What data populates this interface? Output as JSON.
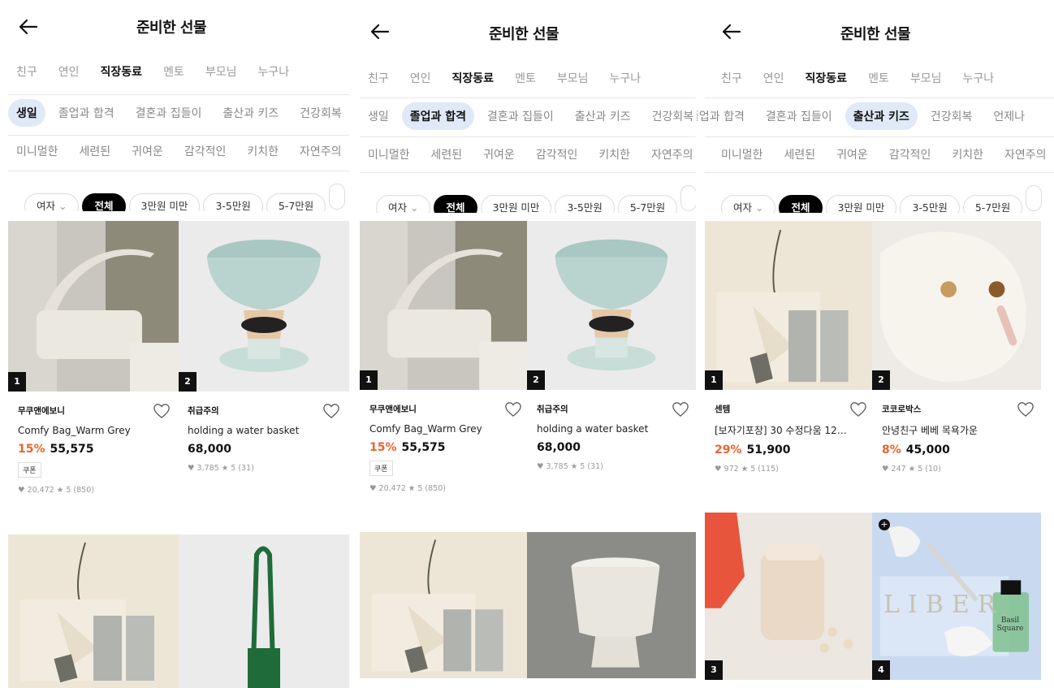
{
  "panels": [
    {
      "title": "준비한 선물",
      "relations": [
        "친구",
        "연인",
        "직장동료",
        "멘토",
        "부모님",
        "누구나"
      ],
      "relation_selected": 2,
      "occasions": [
        "생일",
        "졸업과 합격",
        "결혼과 집들이",
        "출산과 키즈",
        "건강회복"
      ],
      "occasion_selected": 0,
      "styles": [
        "미니멀한",
        "세련된",
        "귀여운",
        "감각적인",
        "키치한",
        "자연주의"
      ],
      "gender": "여자",
      "prices": [
        "전체",
        "3만원 미만",
        "3-5만원",
        "5-7만원"
      ],
      "products": [
        {
          "rank": "1",
          "brand": "무쿠앤에보니",
          "name": "Comfy Bag_Warm Grey",
          "discount": "15%",
          "price": "55,575",
          "coupon": "쿠폰",
          "stats": "♥ 20,472  ★ 5 (850)"
        },
        {
          "rank": "2",
          "brand": "취급주의",
          "name": "holding a water basket",
          "discount": "",
          "price": "68,000",
          "coupon": "",
          "stats": "♥ 3,785  ★ 5 (31)"
        }
      ]
    },
    {
      "title": "준비한 선물",
      "relations": [
        "친구",
        "연인",
        "직장동료",
        "멘토",
        "부모님",
        "누구나"
      ],
      "relation_selected": 2,
      "occasions": [
        "생일",
        "졸업과 합격",
        "결혼과 집들이",
        "출산과 키즈",
        "건강회복"
      ],
      "occasion_selected": 1,
      "styles": [
        "미니멀한",
        "세련된",
        "귀여운",
        "감각적인",
        "키치한",
        "자연주의"
      ],
      "gender": "여자",
      "prices": [
        "전체",
        "3만원 미만",
        "3-5만원",
        "5-7만원"
      ],
      "products": [
        {
          "rank": "1",
          "brand": "무쿠앤에보니",
          "name": "Comfy Bag_Warm Grey",
          "discount": "15%",
          "price": "55,575",
          "coupon": "쿠폰",
          "stats": "♥ 20,472  ★ 5 (850)"
        },
        {
          "rank": "2",
          "brand": "취급주의",
          "name": "holding a water basket",
          "discount": "",
          "price": "68,000",
          "coupon": "",
          "stats": "♥ 3,785  ★ 5 (31)"
        }
      ]
    },
    {
      "title": "준비한 선물",
      "relations": [
        "친구",
        "연인",
        "직장동료",
        "멘토",
        "부모님",
        "누구나"
      ],
      "relation_selected": 2,
      "occasions": [
        "졸업과 합격",
        "결혼과 집들이",
        "출산과 키즈",
        "건강회복",
        "언제나"
      ],
      "occasion_selected": 2,
      "styles": [
        "미니멀한",
        "세련된",
        "귀여운",
        "감각적인",
        "키치한",
        "자연주의"
      ],
      "gender": "여자",
      "prices": [
        "전체",
        "3만원 미만",
        "3-5만원",
        "5-7만원"
      ],
      "products": [
        {
          "rank": "1",
          "brand": "센템",
          "name": "[보자기포장] 30 수정다움 12g...",
          "discount": "29%",
          "price": "51,900",
          "coupon": "",
          "stats": "♥ 972  ★ 5 (115)"
        },
        {
          "rank": "2",
          "brand": "코코로박스",
          "name": "안녕친구 베베 목욕가운",
          "discount": "8%",
          "price": "45,000",
          "coupon": "",
          "stats": "♥ 247  ★ 5 (10)"
        }
      ],
      "lower_ranks": [
        "3",
        "4"
      ],
      "lower_label": "LIBER",
      "lower_bottle_label": "Basil Square"
    }
  ],
  "icons": {
    "back": "arrow-left-icon",
    "heart": "heart-outline-icon",
    "chevron": "chevron-down-icon"
  },
  "colors": {
    "accent_discount": "#e8642c",
    "selected_chip": "#dfe9f7",
    "black": "#000000"
  }
}
